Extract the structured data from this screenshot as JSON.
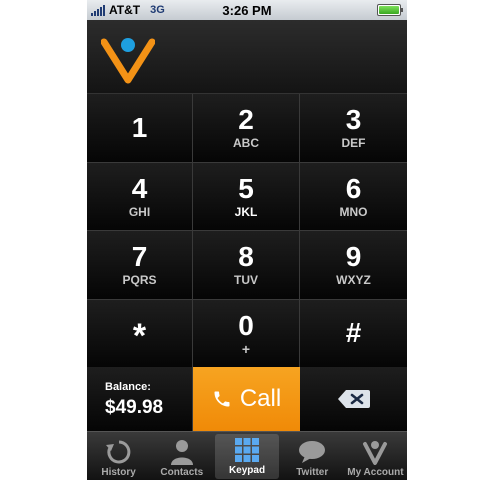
{
  "status": {
    "carrier": "AT&T",
    "network": "3G",
    "time": "3:26 PM",
    "battery_level": 1.0
  },
  "keys": [
    {
      "digit": "1",
      "sub": ""
    },
    {
      "digit": "2",
      "sub": "ABC"
    },
    {
      "digit": "3",
      "sub": "DEF"
    },
    {
      "digit": "4",
      "sub": "GHI"
    },
    {
      "digit": "5",
      "sub": "JKL"
    },
    {
      "digit": "6",
      "sub": "MNO"
    },
    {
      "digit": "7",
      "sub": "PQRS"
    },
    {
      "digit": "8",
      "sub": "TUV"
    },
    {
      "digit": "9",
      "sub": "WXYZ"
    },
    {
      "digit": "*",
      "sub": ""
    },
    {
      "digit": "0",
      "sub": "+"
    },
    {
      "digit": "#",
      "sub": ""
    }
  ],
  "balance": {
    "label": "Balance:",
    "value": "$49.98"
  },
  "call": {
    "label": "Call"
  },
  "tabs": [
    {
      "label": "History",
      "icon": "history-icon"
    },
    {
      "label": "Contacts",
      "icon": "contacts-icon"
    },
    {
      "label": "Keypad",
      "icon": "keypad-icon",
      "active": true
    },
    {
      "label": "Twitter",
      "icon": "twitter-icon"
    },
    {
      "label": "My Account",
      "icon": "account-icon"
    }
  ],
  "colors": {
    "accent": "#F39216",
    "logo_dot": "#1E9FE0",
    "background": "#000000"
  }
}
